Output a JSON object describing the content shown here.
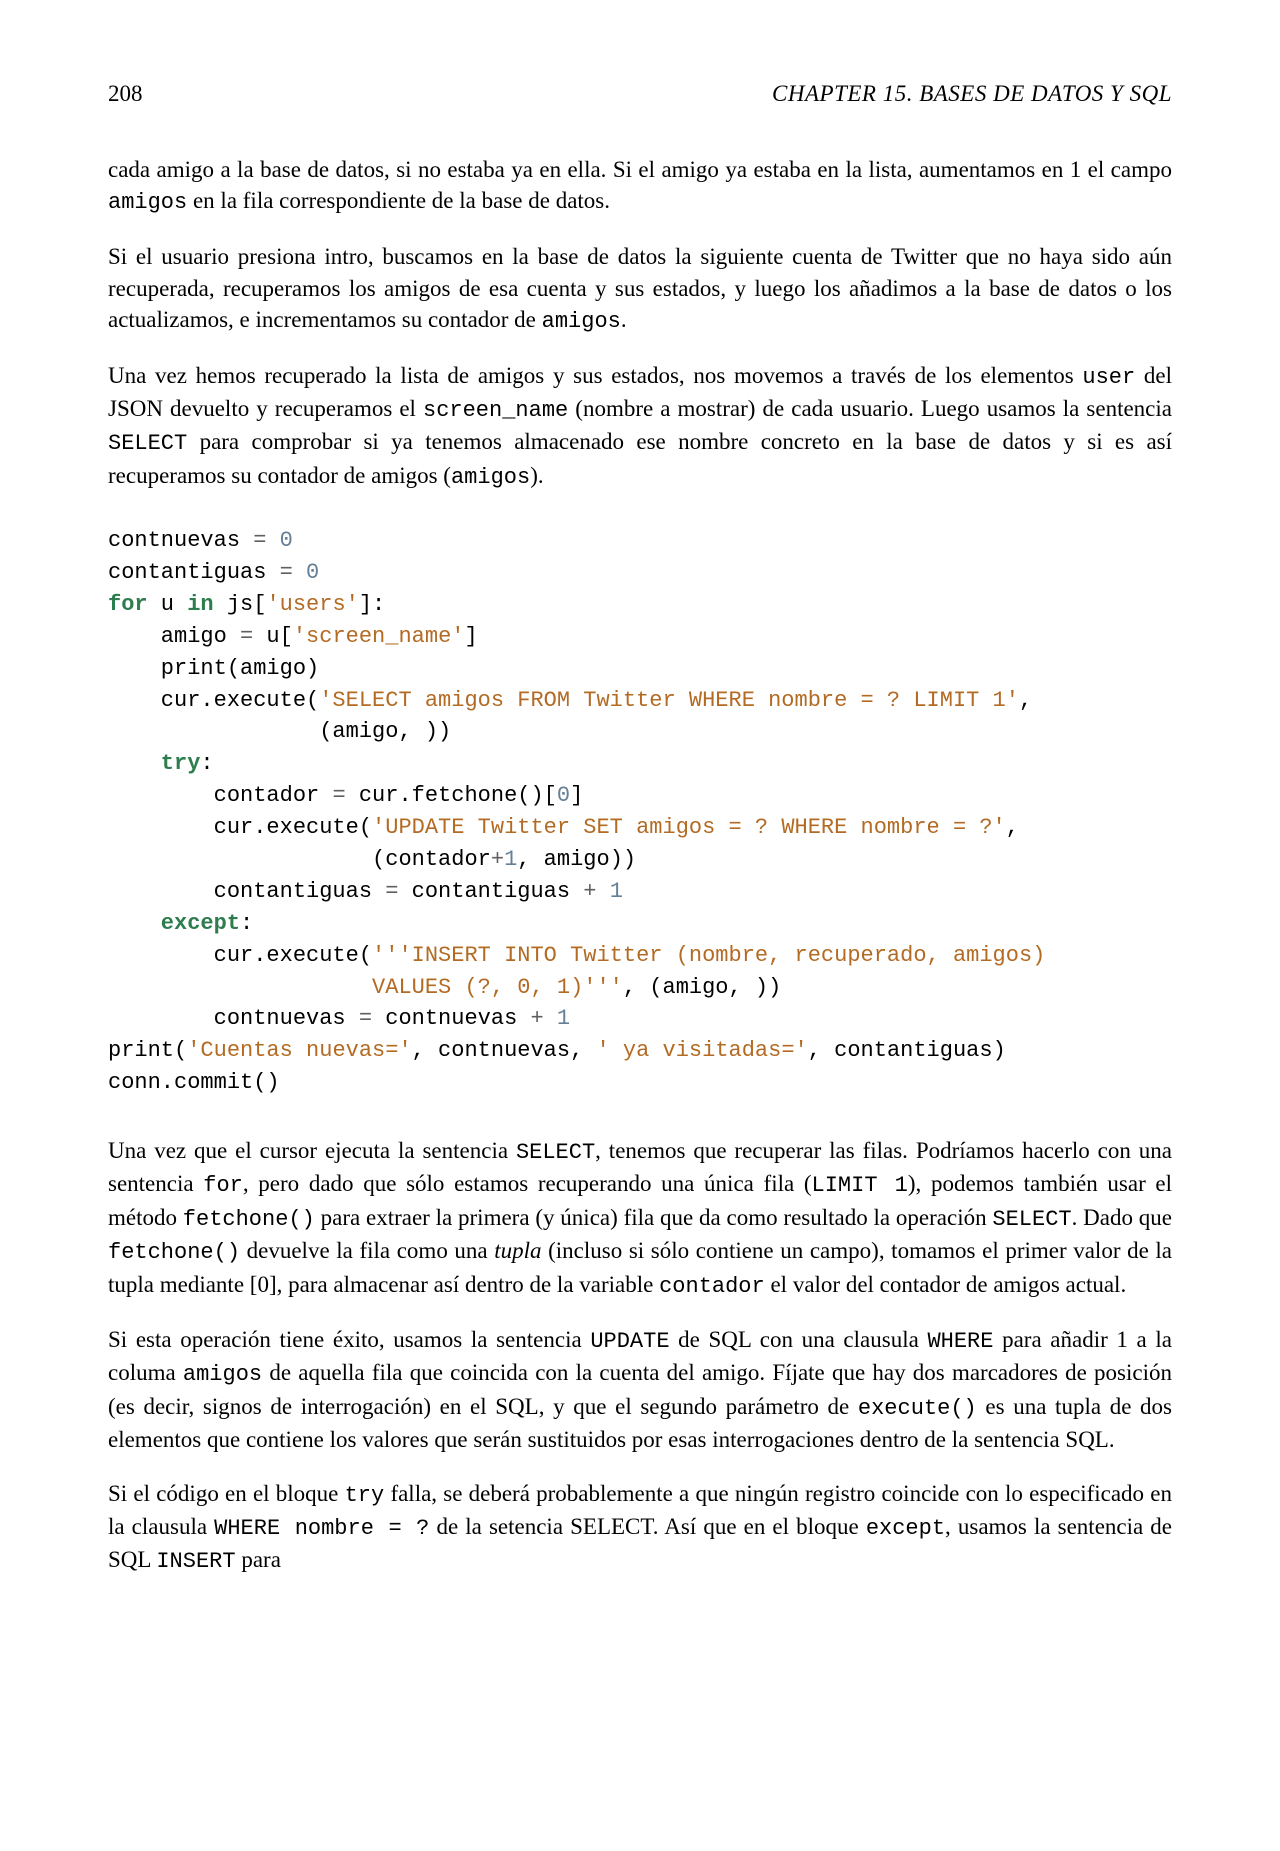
{
  "header": {
    "page_number": "208",
    "chapter_title": "CHAPTER 15.  BASES DE DATOS Y SQL"
  },
  "para1": {
    "t1": "cada amigo a la base de datos, si no estaba ya en ella. Si el amigo ya estaba en la lista, aumentamos en 1 el campo ",
    "c1": "amigos",
    "t2": " en la fila correspondiente de la base de datos."
  },
  "para2": {
    "t1": "Si el usuario presiona intro, buscamos en la base de datos la siguiente cuenta de Twitter que no haya sido aún recuperada, recuperamos los amigos de esa cuenta y sus estados, y luego los añadimos a la base de datos o los actualizamos, e incrementamos su contador de ",
    "c1": "amigos",
    "t2": "."
  },
  "para3": {
    "t1": "Una vez hemos recuperado la lista de amigos y sus estados, nos movemos a través de los elementos ",
    "c1": "user",
    "t2": " del JSON devuelto y recuperamos el ",
    "c2": "screen_name",
    "t3": " (nombre a mostrar) de cada usuario. Luego usamos la sentencia ",
    "c3": "SELECT",
    "t4": " para comprobar si ya tenemos almacenado ese nombre concreto en la base de datos y si es así recuperamos su contador de amigos (",
    "c4": "amigos",
    "t5": ")."
  },
  "code": {
    "l01_a": "contnuevas ",
    "l01_op": "=",
    "l01_sp": " ",
    "l01_n": "0",
    "l02_a": "contantiguas ",
    "l02_op": "=",
    "l02_sp": " ",
    "l02_n": "0",
    "l03_kw": "for",
    "l03_a": " u ",
    "l03_kw2": "in",
    "l03_b": " js[",
    "l03_s": "'users'",
    "l03_c": "]:",
    "l04_a": "    amigo ",
    "l04_op": "=",
    "l04_b": " u[",
    "l04_s": "'screen_name'",
    "l04_c": "]",
    "l05_a": "    print(amigo)",
    "l06_a": "    cur.execute(",
    "l06_s": "'SELECT amigos FROM Twitter WHERE nombre = ? LIMIT 1'",
    "l06_c": ",",
    "l07_a": "                (amigo, ))",
    "l08_kw": "    try",
    "l08_a": ":",
    "l09_a": "        contador ",
    "l09_op": "=",
    "l09_b": " cur.fetchone()[",
    "l09_n": "0",
    "l09_c": "]",
    "l10_a": "        cur.execute(",
    "l10_s": "'UPDATE Twitter SET amigos = ? WHERE nombre = ?'",
    "l10_c": ",",
    "l11_a": "                    (contador",
    "l11_op": "+",
    "l11_n": "1",
    "l11_b": ", amigo))",
    "l12_a": "        contantiguas ",
    "l12_op": "=",
    "l12_b": " contantiguas ",
    "l12_op2": "+",
    "l12_sp": " ",
    "l12_n": "1",
    "l13_kw": "    except",
    "l13_a": ":",
    "l14_a": "        cur.execute(",
    "l14_s": "'''INSERT INTO Twitter (nombre, recuperado, amigos)",
    "l15_s": "                    VALUES (?, 0, 1)'''",
    "l15_a": ", (amigo, ))",
    "l16_a": "        contnuevas ",
    "l16_op": "=",
    "l16_b": " contnuevas ",
    "l16_op2": "+",
    "l16_sp": " ",
    "l16_n": "1",
    "l17_a": "print(",
    "l17_s1": "'Cuentas nuevas='",
    "l17_b": ", contnuevas, ",
    "l17_s2": "' ya visitadas='",
    "l17_c": ", contantiguas)",
    "l18_a": "conn.commit()"
  },
  "para4": {
    "t1": "Una vez que el cursor ejecuta la sentencia ",
    "c1": "SELECT",
    "t2": ", tenemos que recuperar las filas. Podríamos hacerlo con una sentencia ",
    "c2": "for",
    "t3": ", pero dado que sólo estamos recuperando una única fila (",
    "c3": "LIMIT 1",
    "t4": "), podemos también usar el método ",
    "c4": "fetchone()",
    "t5": " para extraer la primera (y única) fila que da como resultado la operación ",
    "c5": "SELECT",
    "t6": ". Dado que ",
    "c6": "fetchone()",
    "t7": " devuelve la fila como una ",
    "em": "tupla",
    "t8": " (incluso si sólo contiene un campo), tomamos el primer valor de la tupla mediante [0], para almacenar así dentro de la variable ",
    "c7": "contador",
    "t9": " el valor del contador de amigos actual."
  },
  "para5": {
    "t1": "Si esta operación tiene éxito, usamos la sentencia ",
    "c1": "UPDATE",
    "t2": " de SQL con una clausula ",
    "c2": "WHERE",
    "t3": " para añadir 1 a la columa ",
    "c3": "amigos",
    "t4": " de aquella fila que coincida con la cuenta del amigo. Fíjate que hay dos marcadores de posición (es decir, signos de interrogación) en el SQL, y que el segundo parámetro de ",
    "c4": "execute()",
    "t5": " es una tupla de dos elementos que contiene los valores que serán sustituidos por esas interrogaciones dentro de la sentencia SQL."
  },
  "para6": {
    "t1": "Si el código en el bloque ",
    "c1": "try",
    "t2": " falla, se deberá probablemente a que ningún registro coincide con lo especificado en la clausula ",
    "c2": "WHERE nombre = ?",
    "t3": " de la setencia SELECT. Así que en el bloque ",
    "c3": "except",
    "t4": ", usamos la sentencia de SQL ",
    "c4": "INSERT",
    "t5": " para"
  }
}
